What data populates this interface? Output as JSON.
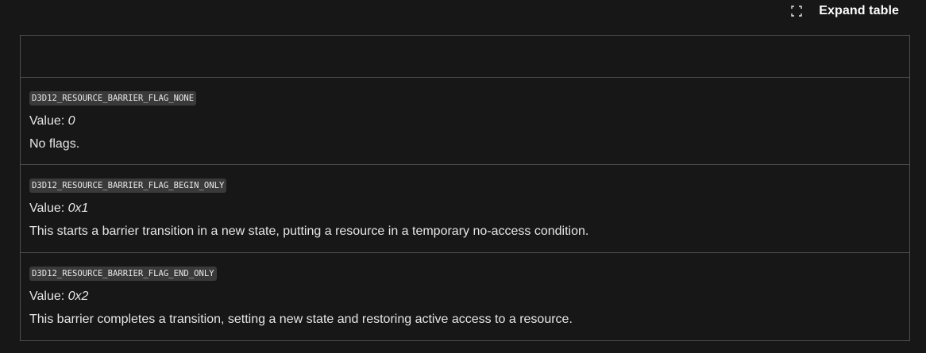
{
  "toolbar": {
    "expand_label": "Expand table"
  },
  "table": {
    "rows": [
      {
        "constant": "D3D12_RESOURCE_BARRIER_FLAG_NONE",
        "value_label": "Value: ",
        "value": "0",
        "description": "No flags."
      },
      {
        "constant": "D3D12_RESOURCE_BARRIER_FLAG_BEGIN_ONLY",
        "value_label": "Value: ",
        "value": "0x1",
        "description": "This starts a barrier transition in a new state, putting a resource in a temporary no-access condition."
      },
      {
        "constant": "D3D12_RESOURCE_BARRIER_FLAG_END_ONLY",
        "value_label": "Value: ",
        "value": "0x2",
        "description": "This barrier completes a transition, setting a new state and restoring active access to a resource."
      }
    ]
  },
  "colors": {
    "background": "#171717",
    "border": "#4e4e4e",
    "code_bg": "#3a3a3a"
  }
}
